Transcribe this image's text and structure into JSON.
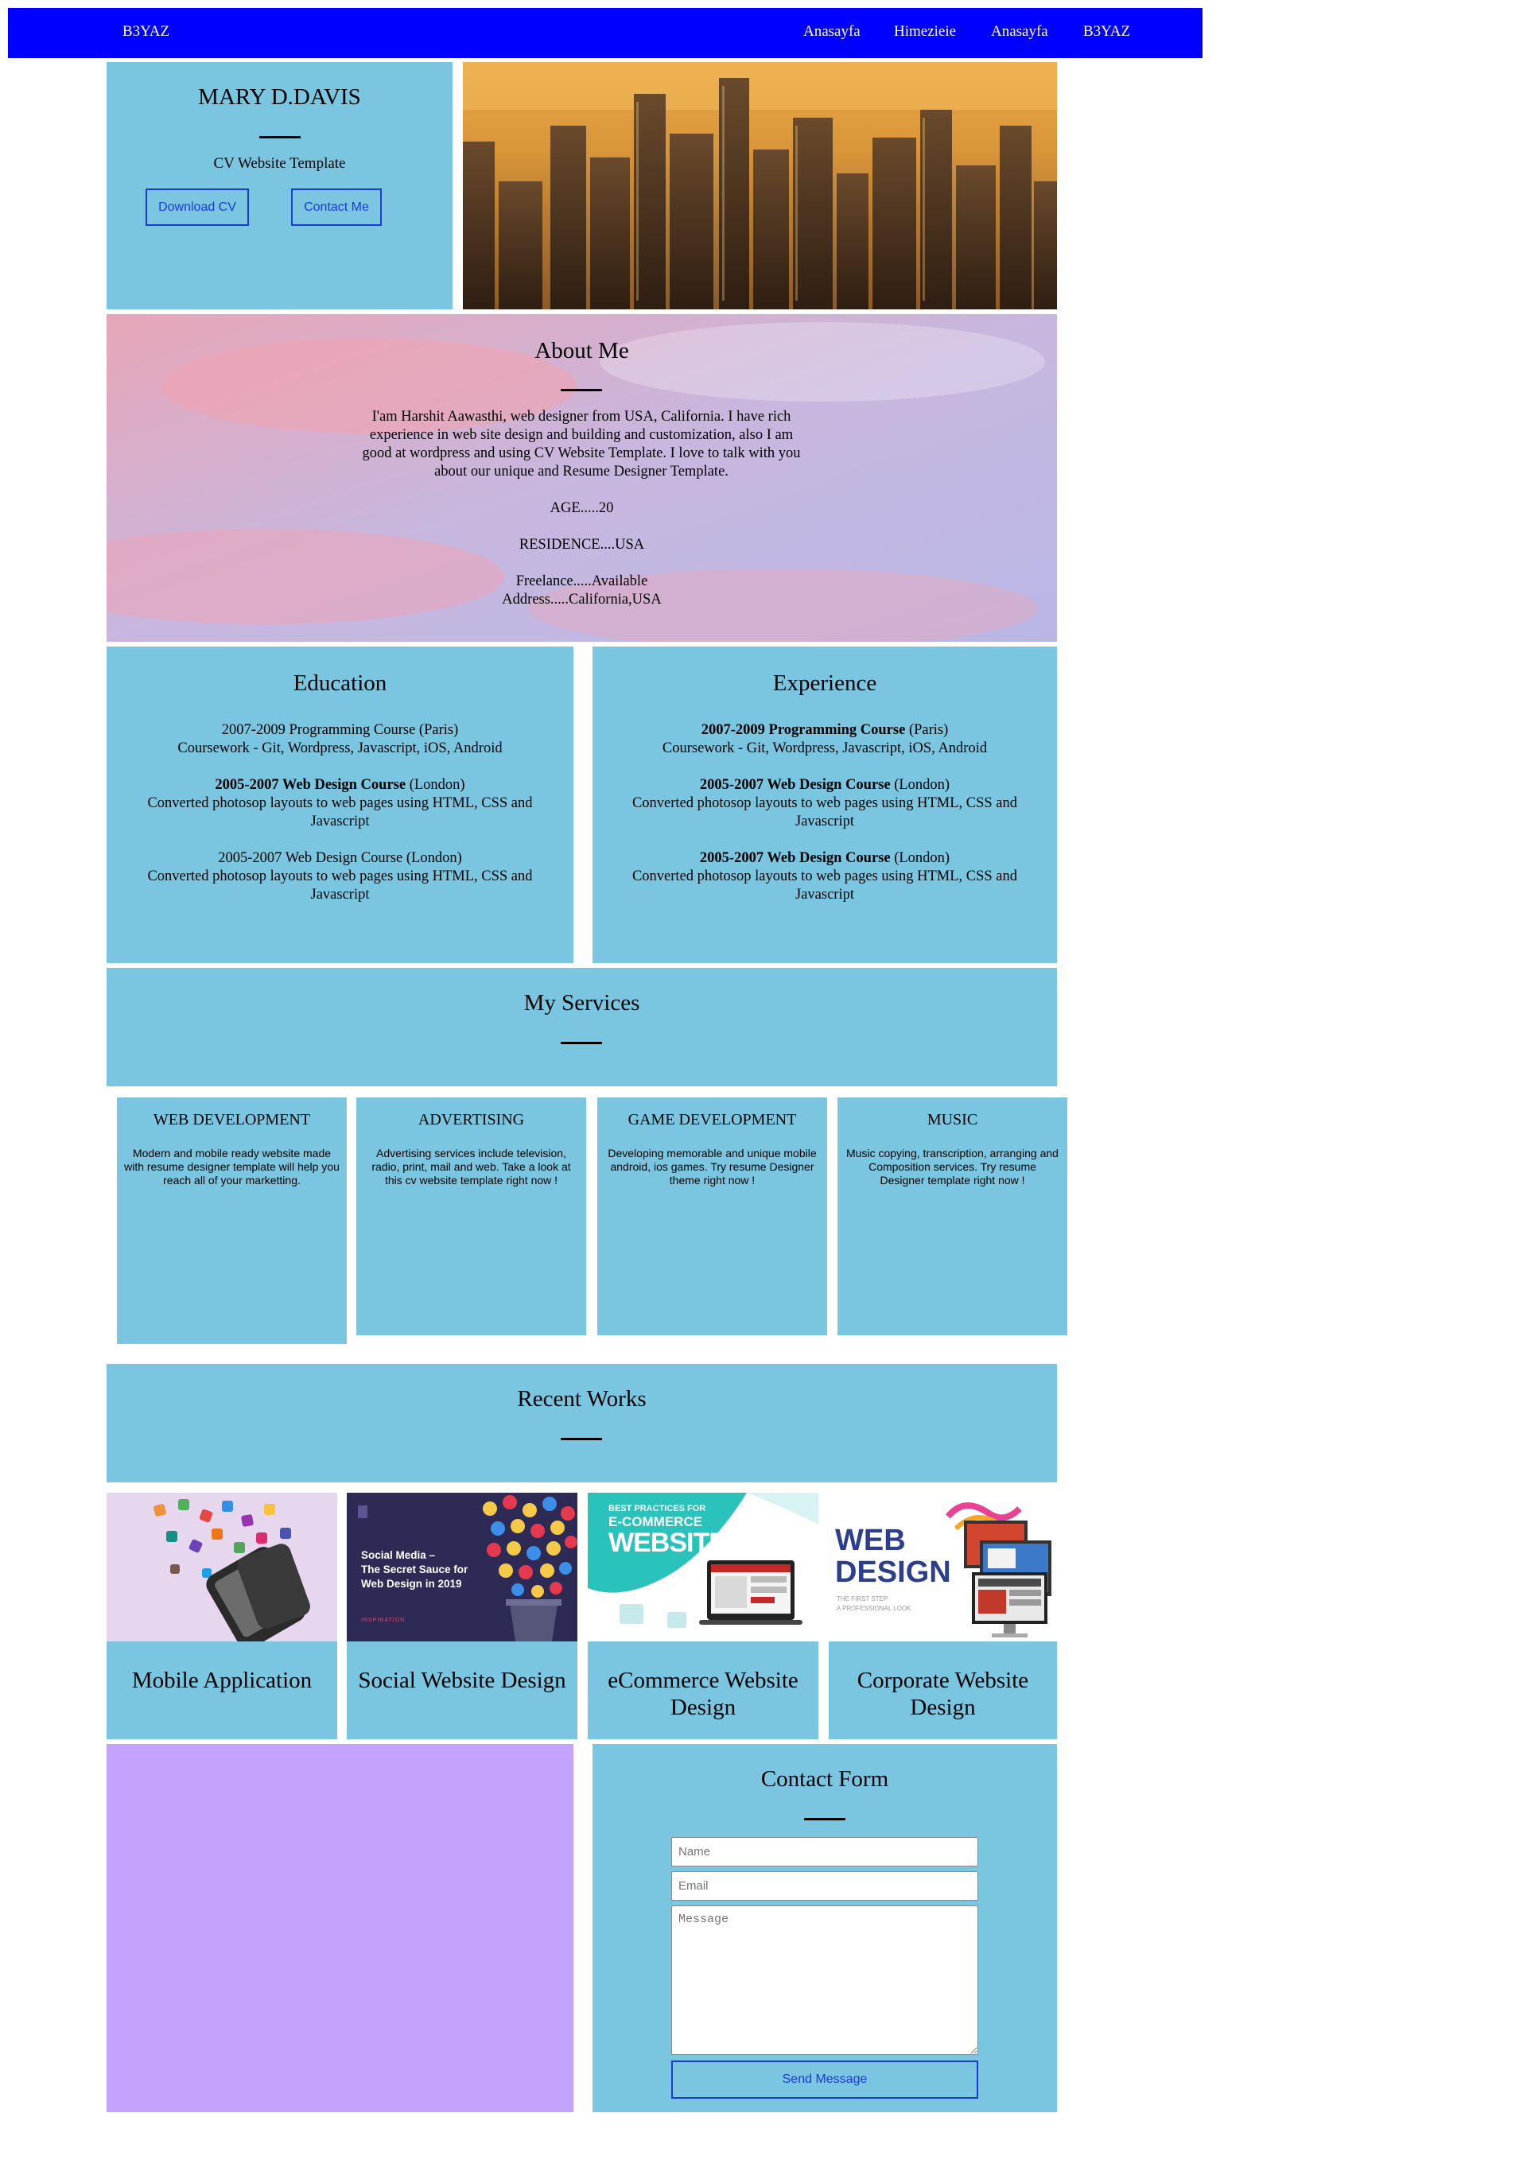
{
  "nav": {
    "brand": "B3YAZ",
    "links": [
      "Anasayfa",
      "Himezieie",
      "Anasayfa",
      "B3YAZ"
    ]
  },
  "hero": {
    "name": "MARY D.DAVIS",
    "subtitle": "CV Website Template",
    "download_label": "Download CV",
    "contact_label": "Contact Me"
  },
  "about": {
    "title": "About Me",
    "bio": "I'am Harshit Aawasthi, web designer from USA, California. I have rich experience in web site design and building and customization, also I am good at wordpress and using CV Website Template. I love to talk with you about our unique and Resume Designer Template.",
    "age": "AGE.....20",
    "residence": "RESIDENCE....USA",
    "freelance": "Freelance.....Available",
    "address": "Address.....California,USA"
  },
  "education": {
    "title": "Education",
    "entries": [
      {
        "head": "2007-2009 Programming Course (Paris)",
        "body": "Coursework - Git, Wordpress, Javascript, iOS, Android"
      },
      {
        "head_bold": "2005-2007 Web Design Course",
        "head_rest": " (London)",
        "body": "Converted photosop layouts to web pages using HTML, CSS and Javascript"
      },
      {
        "head": "2005-2007 Web Design Course (London)",
        "body": "Converted photosop layouts to web pages using HTML, CSS and Javascript"
      }
    ]
  },
  "experience": {
    "title": "Experience",
    "entries": [
      {
        "head_bold": "2007-2009 Programming Course",
        "head_rest": " (Paris)",
        "body": "Coursework - Git, Wordpress, Javascript, iOS, Android"
      },
      {
        "head_bold": "2005-2007 Web Design Course",
        "head_rest": " (London)",
        "body": "Converted photosop layouts to web pages using HTML, CSS and Javascript"
      },
      {
        "head_bold": "2005-2007 Web Design Course",
        "head_rest": " (London)",
        "body": "Converted photosop layouts to web pages using HTML, CSS and Javascript"
      }
    ]
  },
  "services": {
    "title": "My Services",
    "items": [
      {
        "title": "WEB DEVELOPMENT",
        "desc": "Modern and mobile ready website made with resume designer template will help you reach all of your marketting."
      },
      {
        "title": "ADVERTISING",
        "desc": "Advertising services include television, radio, print, mail and web. Take a look at this cv website template right now !"
      },
      {
        "title": "GAME DEVELOPMENT",
        "desc": "Developing memorable and unique mobile android, ios games. Try resume Designer theme right now !"
      },
      {
        "title": "MUSIC",
        "desc": "Music copying, transcription, arranging and Composition services. Try resume Designer template right now !"
      }
    ]
  },
  "works": {
    "title": "Recent Works",
    "items": [
      {
        "title": "Mobile Application"
      },
      {
        "title": "Social Website Design",
        "thumb_text_1": "Social Media –",
        "thumb_text_2": "The Secret Sauce for",
        "thumb_text_3": "Web Design in 2019",
        "thumb_tag": "INSPIRATION"
      },
      {
        "title": "eCommerce Website Design",
        "thumb_text_1": "BEST PRACTICES FOR",
        "thumb_text_2": "E-COMMERCE",
        "thumb_text_3": "WEBSITE"
      },
      {
        "title": "Corporate Website Design",
        "thumb_text_1": "WEB",
        "thumb_text_2": "DESIGN",
        "thumb_text_3": "THE FIRST STEP",
        "thumb_text_4": "A PROFESSIONAL LOOK"
      }
    ]
  },
  "contact": {
    "title": "Contact Form",
    "name_placeholder": "Name",
    "email_placeholder": "Email",
    "message_placeholder": "Message",
    "send_label": "Send Message"
  },
  "colors": {
    "nav": "#0000ff",
    "panel": "#7ac5e0",
    "accent_purple": "#c3a3fb",
    "button_border": "#1a3bd6"
  }
}
